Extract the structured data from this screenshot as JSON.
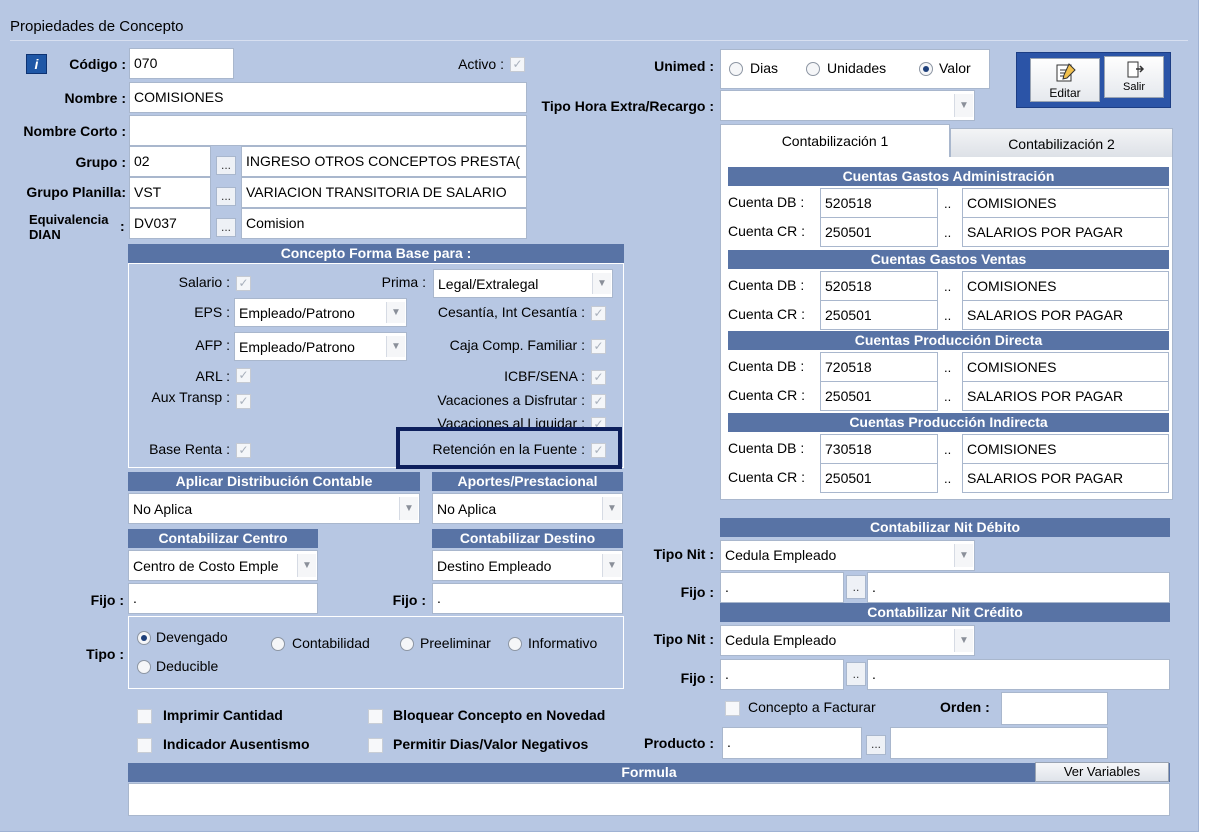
{
  "window": {
    "title": "Propiedades de Concepto"
  },
  "fields": {
    "codigo_label": "Código :",
    "codigo": "070",
    "activo_label": "Activo :",
    "nombre_label": "Nombre :",
    "nombre": "COMISIONES",
    "nombre_corto_label": "Nombre Corto :",
    "nombre_corto": "",
    "grupo_label": "Grupo :",
    "grupo_code": "02",
    "grupo_desc": "INGRESO OTROS CONCEPTOS PRESTA(",
    "grupo_planilla_label": "Grupo Planilla:",
    "grupo_planilla_code": "VST",
    "grupo_planilla_desc": "VARIACION TRANSITORIA DE SALARIO",
    "equivalencia_label_1": "Equivalencia",
    "equivalencia_label_2": "DIAN",
    "equivalencia_colon": ":",
    "equivalencia_code": "DV037",
    "equivalencia_desc": "Comision",
    "dots": "..."
  },
  "unimed": {
    "label": "Unimed :",
    "options": [
      "Dias",
      "Unidades",
      "Valor"
    ],
    "selected": "Valor"
  },
  "tipo_hora": {
    "label": "Tipo Hora Extra/Recargo :",
    "value": ""
  },
  "toolbar": {
    "editar": "Editar",
    "salir": "Salir"
  },
  "forma_base": {
    "title": "Concepto Forma Base para :",
    "salario": "Salario :",
    "prima_label": "Prima :",
    "prima_value": "Legal/Extralegal",
    "eps_label": "EPS :",
    "eps_value": "Empleado/Patrono",
    "cesantia": "Cesantía, Int Cesantía :",
    "afp_label": "AFP :",
    "afp_value": "Empleado/Patrono",
    "caja": "Caja Comp. Familiar :",
    "arl": "ARL :",
    "icbf": "ICBF/SENA :",
    "aux": "Aux Transp :",
    "vac_disfrutar": "Vacaciones a Disfrutar :",
    "vac_liquidar": "Vacaciones al Liquidar :",
    "base_renta": "Base Renta :",
    "retencion": "Retención en la Fuente :"
  },
  "distribucion": {
    "title": "Aplicar Distribución Contable",
    "value": "No Aplica"
  },
  "aportes": {
    "title": "Aportes/Prestacional",
    "value": "No Aplica"
  },
  "centro": {
    "title": "Contabilizar Centro",
    "value": "Centro de Costo Emple",
    "fijo_label": "Fijo :",
    "fijo_value": "."
  },
  "destino": {
    "title": "Contabilizar Destino",
    "value": "Destino Empleado",
    "fijo_label": "Fijo :",
    "fijo_value": "."
  },
  "tipo": {
    "label": "Tipo :",
    "options": [
      "Devengado",
      "Contabilidad",
      "Preeliminar",
      "Informativo",
      "Deducible"
    ],
    "selected": "Devengado"
  },
  "checks": {
    "imprimir": "Imprimir Cantidad",
    "bloquear": "Bloquear Concepto en Novedad",
    "ausentismo": "Indicador Ausentismo",
    "negativos": "Permitir Dias/Valor Negativos",
    "facturar": "Concepto a Facturar"
  },
  "orden_label": "Orden :",
  "producto": {
    "label": "Producto :",
    "code": ".",
    "desc": ""
  },
  "formula": {
    "title": "Formula",
    "button": "Ver Variables",
    "value": ""
  },
  "tabs": [
    "Contabilización 1",
    "Contabilización 2"
  ],
  "cuentas": [
    {
      "title": "Cuentas Gastos Administración",
      "rows": [
        {
          "label": "Cuenta DB :",
          "code": "520518",
          "desc": "COMISIONES"
        },
        {
          "label": "Cuenta CR :",
          "code": "250501",
          "desc": "SALARIOS POR PAGAR"
        }
      ]
    },
    {
      "title": "Cuentas Gastos Ventas",
      "rows": [
        {
          "label": "Cuenta DB :",
          "code": "520518",
          "desc": "COMISIONES"
        },
        {
          "label": "Cuenta CR :",
          "code": "250501",
          "desc": "SALARIOS POR PAGAR"
        }
      ]
    },
    {
      "title": "Cuentas Producción Directa",
      "rows": [
        {
          "label": "Cuenta DB :",
          "code": "720518",
          "desc": "COMISIONES"
        },
        {
          "label": "Cuenta CR :",
          "code": "250501",
          "desc": "SALARIOS POR PAGAR"
        }
      ]
    },
    {
      "title": "Cuentas Producción Indirecta",
      "rows": [
        {
          "label": "Cuenta DB :",
          "code": "730518",
          "desc": "COMISIONES"
        },
        {
          "label": "Cuenta CR :",
          "code": "250501",
          "desc": "SALARIOS POR PAGAR"
        }
      ]
    }
  ],
  "dots_small": "..",
  "nit_debito": {
    "title": "Contabilizar Nit Débito",
    "tipo_label": "Tipo Nit :",
    "tipo_value": "Cedula Empleado",
    "fijo_label": "Fijo :",
    "fijo_code": ".",
    "fijo_desc": "."
  },
  "nit_credito": {
    "title": "Contabilizar Nit Crédito",
    "tipo_label": "Tipo Nit :",
    "tipo_value": "Cedula Empleado",
    "fijo_label": "Fijo :",
    "fijo_code": ".",
    "fijo_desc": "."
  },
  "colors": {
    "header": "#5873a5",
    "background": "#b7c7e3",
    "highlight": "#0d1f5c"
  }
}
